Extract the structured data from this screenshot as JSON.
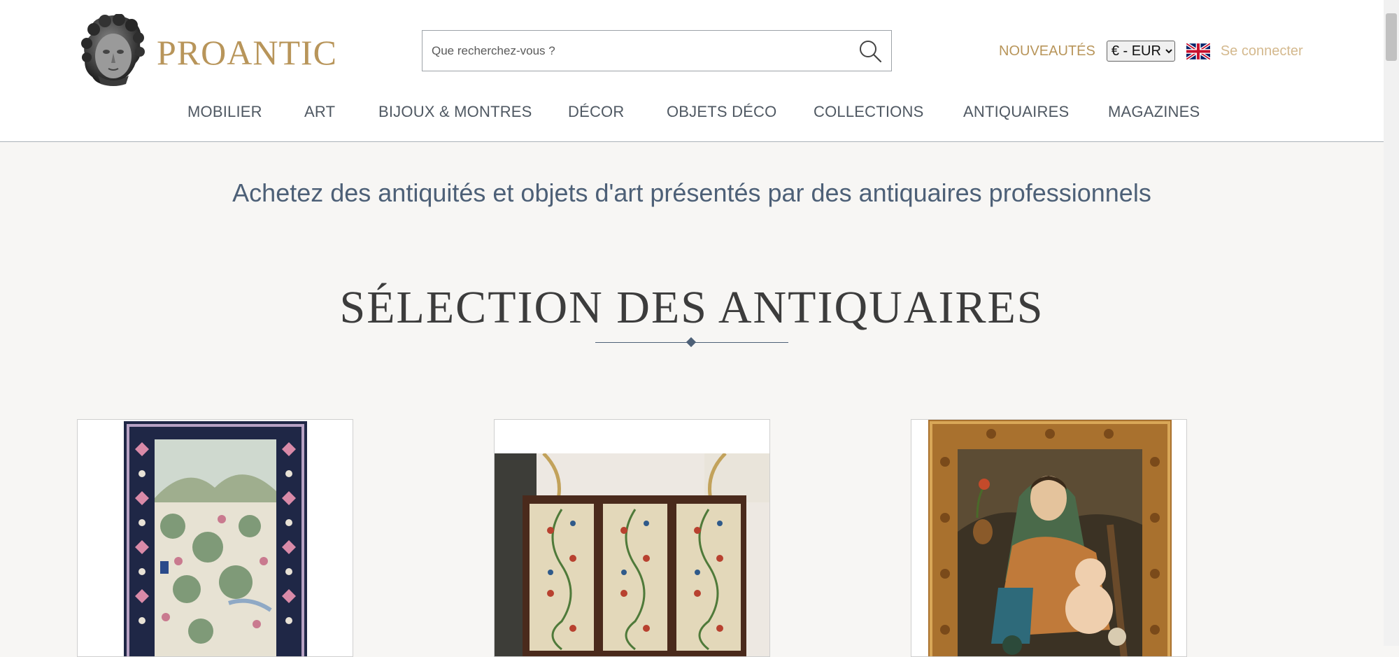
{
  "brand": {
    "name": "PROANTIC",
    "logo_icon": "sculpted-head-icon",
    "color": "#b8955a"
  },
  "search": {
    "placeholder": "Que recherchez-vous ?",
    "value": "",
    "icon": "search-icon"
  },
  "header_links": {
    "new_label": "NOUVEAUTÉS",
    "currency_selected": "€ - EUR",
    "currency_options": [
      "€ - EUR"
    ],
    "language_icon": "uk-flag-icon",
    "login_label": "Se connecter"
  },
  "nav": {
    "items": [
      {
        "label": "MOBILIER"
      },
      {
        "label": "ART"
      },
      {
        "label": "BIJOUX & MONTRES"
      },
      {
        "label": "DÉCOR"
      },
      {
        "label": "OBJETS DÉCO"
      },
      {
        "label": "COLLECTIONS"
      },
      {
        "label": "ANTIQUAIRES"
      },
      {
        "label": "MAGAZINES"
      }
    ]
  },
  "main": {
    "tagline": "Achetez des antiquités et objets d'art présentés par des antiquaires professionnels",
    "section_title": "SÉLECTION DES ANTIQUAIRES",
    "products": [
      {
        "image": "persian-rug-image"
      },
      {
        "image": "embroidered-screen-image"
      },
      {
        "image": "madonna-painting-image"
      }
    ]
  },
  "colors": {
    "accent_gold": "#b8955a",
    "login_gold": "#d4b98e",
    "nav_text": "#4f5862",
    "tagline_blue": "#4d6077",
    "page_background": "#f7f6f4"
  }
}
